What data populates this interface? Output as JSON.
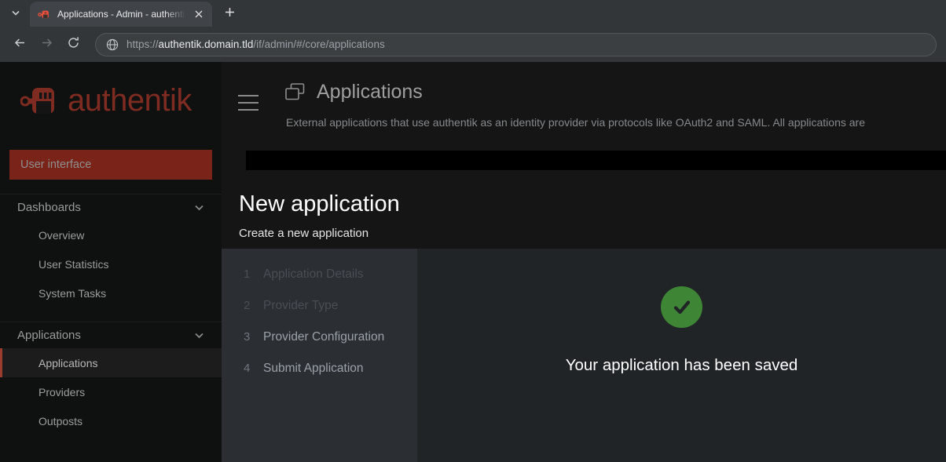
{
  "browser": {
    "tab": {
      "title": "Applications - Admin - authentik",
      "favicon_icon": "authentik-favicon",
      "close_icon": "close-icon"
    },
    "tab_list_icon": "chevron-down-icon",
    "new_tab_icon": "plus-icon",
    "back_icon": "arrow-left-icon",
    "forward_icon": "arrow-right-icon",
    "reload_icon": "reload-icon",
    "omnibox": {
      "site_icon": "globe-icon",
      "url_scheme": "https://",
      "url_host": "authentik.domain.tld",
      "url_path": "/if/admin/#/core/applications"
    }
  },
  "sidebar": {
    "logo_text": "authentik",
    "logo_icon": "authentik-logo",
    "banner_label": "User interface",
    "groups": [
      {
        "label": "Dashboards",
        "chevron_icon": "chevron-down-icon",
        "items": [
          {
            "label": "Overview",
            "active": false
          },
          {
            "label": "User Statistics",
            "active": false
          },
          {
            "label": "System Tasks",
            "active": false
          }
        ]
      },
      {
        "label": "Applications",
        "chevron_icon": "chevron-down-icon",
        "items": [
          {
            "label": "Applications",
            "active": true
          },
          {
            "label": "Providers",
            "active": false
          },
          {
            "label": "Outposts",
            "active": false
          }
        ]
      }
    ]
  },
  "page": {
    "hamburger_icon": "hamburger-icon",
    "title_icon": "applications-window-icon",
    "title": "Applications",
    "subtitle": "External applications that use authentik as an identity provider via protocols like OAuth2 and SAML. All applications are"
  },
  "modal": {
    "title": "New application",
    "subtitle": "Create a new application",
    "steps": [
      {
        "num": "1",
        "label": "Application Details",
        "state": "dim"
      },
      {
        "num": "2",
        "label": "Provider Type",
        "state": "dim"
      },
      {
        "num": "3",
        "label": "Provider Configuration",
        "state": "lit"
      },
      {
        "num": "4",
        "label": "Submit Application",
        "state": "lit"
      }
    ],
    "result": {
      "icon": "check-circle-icon",
      "message": "Your application has been saved"
    }
  },
  "colors": {
    "brand_red": "#7a2419",
    "accent_red": "#9c3c2d",
    "success_green": "#3e8635",
    "steps_panel": "#2b2e33",
    "content_panel": "#212427"
  }
}
